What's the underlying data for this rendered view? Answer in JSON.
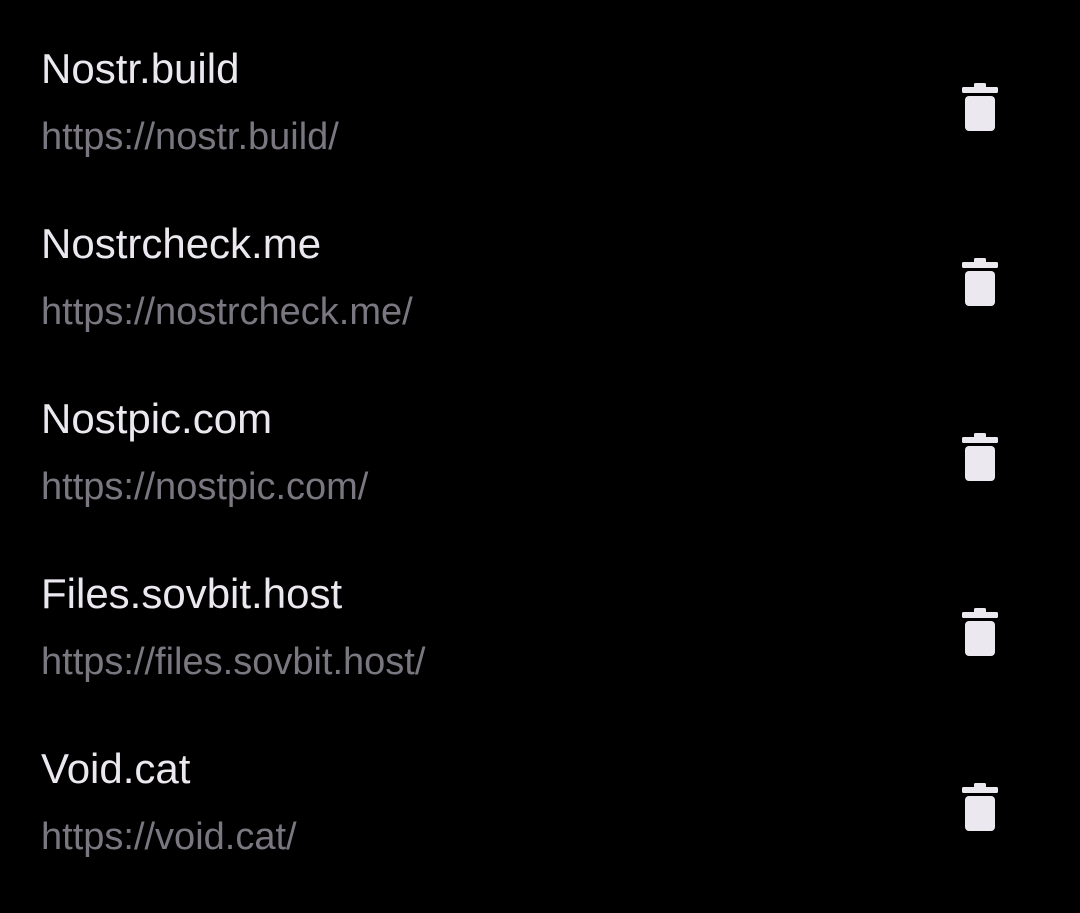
{
  "servers": [
    {
      "name": "Nostr.build",
      "url": "https://nostr.build/",
      "action_icon": "trash-icon"
    },
    {
      "name": "Nostrcheck.me",
      "url": "https://nostrcheck.me/",
      "action_icon": "trash-icon"
    },
    {
      "name": "Nostpic.com",
      "url": "https://nostpic.com/",
      "action_icon": "trash-icon"
    },
    {
      "name": "Files.sovbit.host",
      "url": "https://files.sovbit.host/",
      "action_icon": "trash-icon"
    },
    {
      "name": "Void.cat",
      "url": "https://void.cat/",
      "action_icon": "trash-icon"
    }
  ],
  "colors": {
    "background": "#000000",
    "primary_text": "#ECE8EF",
    "secondary_text": "#7A7780",
    "icon": "#ECE8EF"
  }
}
